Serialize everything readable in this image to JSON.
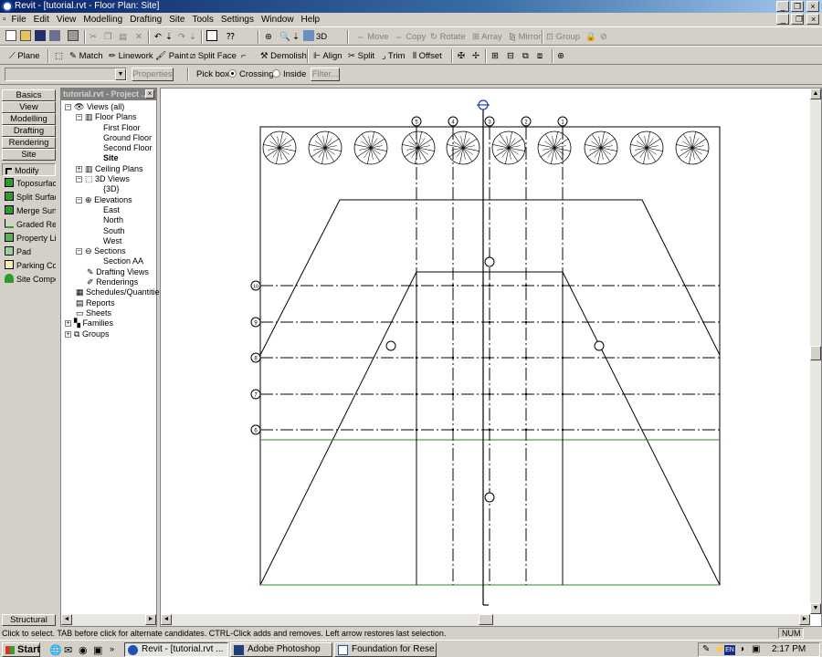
{
  "window": {
    "title": "Revit - [tutorial.rvt - Floor Plan: Site]"
  },
  "menu": [
    "File",
    "Edit",
    "View",
    "Modelling",
    "Drafting",
    "Site",
    "Tools",
    "Settings",
    "Window",
    "Help"
  ],
  "toolbar1": {
    "view3d_label": "3D",
    "move": "Move",
    "copy": "Copy",
    "rotate": "Rotate",
    "array": "Array",
    "mirror": "Mirror",
    "group": "Group"
  },
  "toolbar2": {
    "plane": "Plane",
    "match": "Match",
    "linework": "Linework",
    "paint": "Paint",
    "split_face": "Split Face",
    "demolish": "Demolish",
    "align": "Align",
    "split": "Split",
    "trim": "Trim",
    "offset": "Offset"
  },
  "options_bar": {
    "combo_value": "",
    "properties": "Properties",
    "pick_box_label": "Pick box:",
    "crossing": "Crossing",
    "inside": "Inside",
    "filter": "Filter..."
  },
  "design_bar": {
    "tabs": [
      "Basics",
      "View",
      "Modelling",
      "Drafting",
      "Rendering",
      "Site"
    ],
    "tools": [
      "Modify",
      "Toposurface",
      "Split Surface",
      "Merge Surfac",
      "Graded Regi",
      "Property Line",
      "Pad",
      "Parking Comp",
      "Site Compon"
    ],
    "bottom_tab": "Structural"
  },
  "project_browser": {
    "title": "tutorial.rvt - Project ...",
    "views_all": "Views (all)",
    "floor_plans": "Floor Plans",
    "floor_items": [
      "First Floor",
      "Ground Floor",
      "Second Floor",
      "Site"
    ],
    "ceiling_plans": "Ceiling Plans",
    "views_3d": "3D Views",
    "views_3d_items": [
      "{3D}"
    ],
    "elevations": "Elevations",
    "elevation_items": [
      "East",
      "North",
      "South",
      "West"
    ],
    "sections": "Sections",
    "section_items": [
      "Section AA"
    ],
    "drafting_views": "Drafting Views",
    "renderings": "Renderings",
    "schedules": "Schedules/Quantities",
    "reports": "Reports",
    "sheets": "Sheets",
    "families": "Families",
    "groups": "Groups"
  },
  "drawing": {
    "vertical_grid_labels": [
      "5",
      "4",
      "3",
      "2",
      "1"
    ],
    "horizontal_grid_labels": [
      "10",
      "9",
      "8",
      "7",
      "6"
    ]
  },
  "status_bar": {
    "message": "Click to select. TAB before click for alternate candidates. CTRL-Click adds and removes. Left arrow restores last selection.",
    "num": "NUM"
  },
  "taskbar": {
    "start": "Start",
    "tasks": [
      "Revit - [tutorial.rvt ...",
      "Adobe Photoshop",
      "Foundation for Rese..."
    ],
    "lang": "EN",
    "time": "2:17 PM"
  }
}
